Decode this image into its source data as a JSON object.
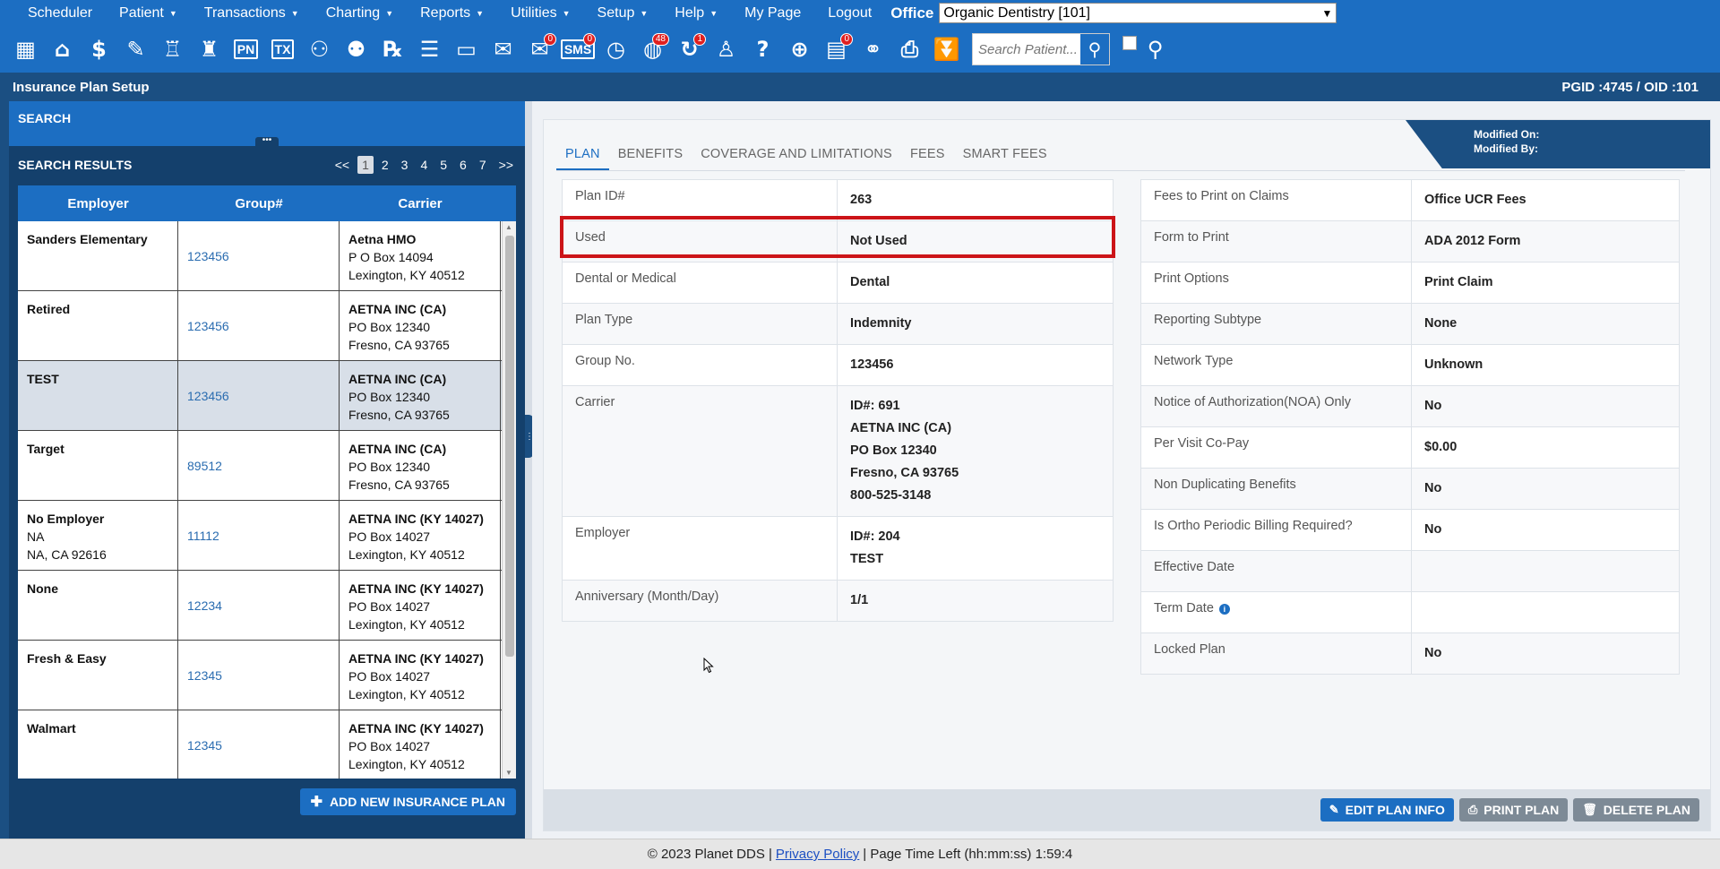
{
  "nav": {
    "items": [
      {
        "label": "Scheduler",
        "caret": false
      },
      {
        "label": "Patient",
        "caret": true
      },
      {
        "label": "Transactions",
        "caret": true
      },
      {
        "label": "Charting",
        "caret": true
      },
      {
        "label": "Reports",
        "caret": true
      },
      {
        "label": "Utilities",
        "caret": true
      },
      {
        "label": "Setup",
        "caret": true
      },
      {
        "label": "Help",
        "caret": true
      },
      {
        "label": "My Page",
        "caret": false
      },
      {
        "label": "Logout",
        "caret": false
      }
    ],
    "office_label": "Office",
    "office_value": "Organic Dentistry [101]"
  },
  "toolbar": {
    "badges": {
      "messages": "0",
      "sms": "0",
      "web": "48",
      "recall": "1",
      "forms": "0"
    },
    "sms_label": "SMS",
    "pn_label": "PN",
    "tx_label": "TX",
    "search_placeholder": "Search Patient..."
  },
  "titlebar": {
    "title": "Insurance Plan Setup",
    "ids": "PGID :4745  /  OID :101"
  },
  "left": {
    "search_header": "SEARCH",
    "handle": "•••",
    "results_title": "SEARCH RESULTS",
    "pager": {
      "prev": "<<",
      "pages": [
        "1",
        "2",
        "3",
        "4",
        "5",
        "6",
        "7"
      ],
      "next": ">>",
      "active": "1"
    },
    "columns": [
      "Employer",
      "Group#",
      "Carrier"
    ],
    "rows": [
      {
        "employer": [
          "Sanders Elementary"
        ],
        "group": "123456",
        "carrier": [
          "Aetna HMO",
          "P O Box 14094",
          "Lexington, KY 40512"
        ]
      },
      {
        "employer": [
          "Retired"
        ],
        "group": "123456",
        "carrier": [
          "AETNA INC (CA)",
          "PO Box 12340",
          "Fresno, CA 93765"
        ]
      },
      {
        "employer": [
          "TEST"
        ],
        "group": "123456",
        "carrier": [
          "AETNA INC (CA)",
          "PO Box 12340",
          "Fresno, CA 93765"
        ],
        "selected": true
      },
      {
        "employer": [
          "Target"
        ],
        "group": "89512",
        "carrier": [
          "AETNA INC (CA)",
          "PO Box 12340",
          "Fresno, CA 93765"
        ]
      },
      {
        "employer": [
          "No Employer",
          "NA",
          "NA, CA 92616"
        ],
        "group": "11112",
        "carrier": [
          "AETNA INC (KY 14027)",
          "PO Box 14027",
          "Lexington, KY 40512"
        ]
      },
      {
        "employer": [
          "None"
        ],
        "group": "12234",
        "carrier": [
          "AETNA INC (KY 14027)",
          "PO Box 14027",
          "Lexington, KY 40512"
        ]
      },
      {
        "employer": [
          "Fresh & Easy"
        ],
        "group": "12345",
        "carrier": [
          "AETNA INC (KY 14027)",
          "PO Box 14027",
          "Lexington, KY 40512"
        ]
      },
      {
        "employer": [
          "Walmart"
        ],
        "group": "12345",
        "carrier": [
          "AETNA INC (KY 14027)",
          "PO Box 14027",
          "Lexington, KY 40512"
        ]
      }
    ],
    "add_button": "ADD NEW INSURANCE PLAN"
  },
  "right": {
    "modified_on": "Modified On:",
    "modified_by": "Modified By:",
    "tabs": [
      "PLAN",
      "BENEFITS",
      "COVERAGE AND LIMITATIONS",
      "FEES",
      "SMART FEES"
    ],
    "active_tab": "PLAN",
    "plan_left": [
      {
        "label": "Plan ID#",
        "value": [
          "263"
        ]
      },
      {
        "label": "Used",
        "value": [
          "Not Used"
        ]
      },
      {
        "label": "Dental or Medical",
        "value": [
          "Dental"
        ]
      },
      {
        "label": "Plan Type",
        "value": [
          "Indemnity"
        ]
      },
      {
        "label": "Group No.",
        "value": [
          "123456"
        ]
      },
      {
        "label": "Carrier",
        "value": [
          "ID#: 691",
          "AETNA INC (CA)",
          "PO Box 12340",
          "Fresno, CA 93765",
          "800-525-3148"
        ]
      },
      {
        "label": "Employer",
        "value": [
          "ID#: 204",
          "TEST"
        ]
      },
      {
        "label": "Anniversary (Month/Day)",
        "value": [
          "1/1"
        ]
      }
    ],
    "plan_right": [
      {
        "label": "Fees to Print on Claims",
        "value": "Office UCR Fees"
      },
      {
        "label": "Form to Print",
        "value": "ADA 2012 Form"
      },
      {
        "label": "Print Options",
        "value": "Print Claim"
      },
      {
        "label": "Reporting Subtype",
        "value": "None"
      },
      {
        "label": "Network Type",
        "value": "Unknown"
      },
      {
        "label": "Notice of Authorization(NOA) Only",
        "value": "No"
      },
      {
        "label": "Per Visit Co-Pay",
        "value": "$0.00"
      },
      {
        "label": "Non Duplicating Benefits",
        "value": "No"
      },
      {
        "label": "Is Ortho Periodic Billing Required?",
        "value": "No"
      },
      {
        "label": "Effective Date",
        "value": ""
      },
      {
        "label": "Term Date",
        "value": "",
        "info": true
      },
      {
        "label": "Locked Plan",
        "value": "No"
      }
    ],
    "buttons": {
      "edit": "EDIT PLAN INFO",
      "print": "PRINT PLAN",
      "delete": "DELETE PLAN"
    }
  },
  "footer": {
    "copyright": "© 2023 Planet DDS |",
    "privacy": "Privacy Policy",
    "time": "|  Page Time Left (hh:mm:ss) 1:59:4"
  },
  "colors": {
    "primary": "#1c6ec2",
    "dark": "#1b4f82",
    "highlight": "#cc1418"
  }
}
